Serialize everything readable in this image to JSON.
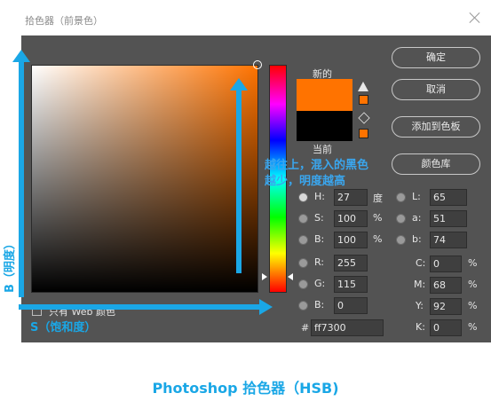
{
  "window": {
    "title": "拾色器（前景色）"
  },
  "preview": {
    "new_label": "新的",
    "current_label": "当前",
    "new_color": "#ff7300",
    "current_color": "#000000",
    "warning_icon": "gamut-warning-icon",
    "cube_icon": "web-safe-cube-icon"
  },
  "buttons": {
    "ok": "确定",
    "cancel": "取消",
    "add_swatch": "添加到色板",
    "libraries": "颜色库"
  },
  "hsb": {
    "h": {
      "label": "H:",
      "value": "27",
      "unit": "度"
    },
    "s": {
      "label": "S:",
      "value": "100",
      "unit": "%"
    },
    "b": {
      "label": "B:",
      "value": "100",
      "unit": "%"
    }
  },
  "rgb": {
    "r": {
      "label": "R:",
      "value": "255"
    },
    "g": {
      "label": "G:",
      "value": "115"
    },
    "b": {
      "label": "B:",
      "value": "0"
    }
  },
  "lab": {
    "l": {
      "label": "L:",
      "value": "65"
    },
    "a": {
      "label": "a:",
      "value": "51"
    },
    "b": {
      "label": "b:",
      "value": "74"
    }
  },
  "cmyk": {
    "c": {
      "label": "C:",
      "value": "0",
      "unit": "%"
    },
    "m": {
      "label": "M:",
      "value": "68",
      "unit": "%"
    },
    "y": {
      "label": "Y:",
      "value": "92",
      "unit": "%"
    },
    "k": {
      "label": "K:",
      "value": "0",
      "unit": "%"
    }
  },
  "hex": {
    "label": "#",
    "value": "ff7300"
  },
  "web_only": {
    "label": "只有 Web 颜色",
    "checked": false
  },
  "annotations": {
    "brightness_axis": "B（明度）",
    "saturation_axis": "S（饱和度）",
    "middle_note": "越往上，混入的黑色越少，明度越高",
    "caption": "Photoshop 拾色器（HSB)"
  },
  "colors": {
    "accent": "#1aa7e6",
    "panel": "#535353"
  }
}
